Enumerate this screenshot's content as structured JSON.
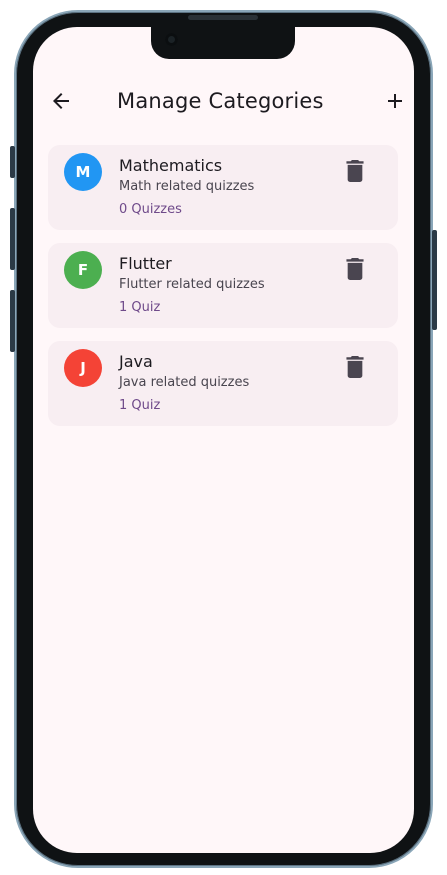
{
  "appbar": {
    "title": "Manage Categories",
    "back_icon": "arrow-left-icon",
    "add_icon": "plus-icon"
  },
  "categories": [
    {
      "initial": "M",
      "name": "Mathematics",
      "description": "Math related quizzes",
      "count_label": "0 Quizzes",
      "avatar_color": "#2196f3"
    },
    {
      "initial": "F",
      "name": "Flutter",
      "description": "Flutter related quizzes",
      "count_label": "1 Quiz",
      "avatar_color": "#4caf50"
    },
    {
      "initial": "J",
      "name": "Java",
      "description": "Java related quizzes",
      "count_label": "1 Quiz",
      "avatar_color": "#f44336"
    }
  ],
  "colors": {
    "background": "#fff7f9",
    "card": "#f8eef2",
    "count_text": "#6f4a8a",
    "icon": "#4a4550"
  }
}
